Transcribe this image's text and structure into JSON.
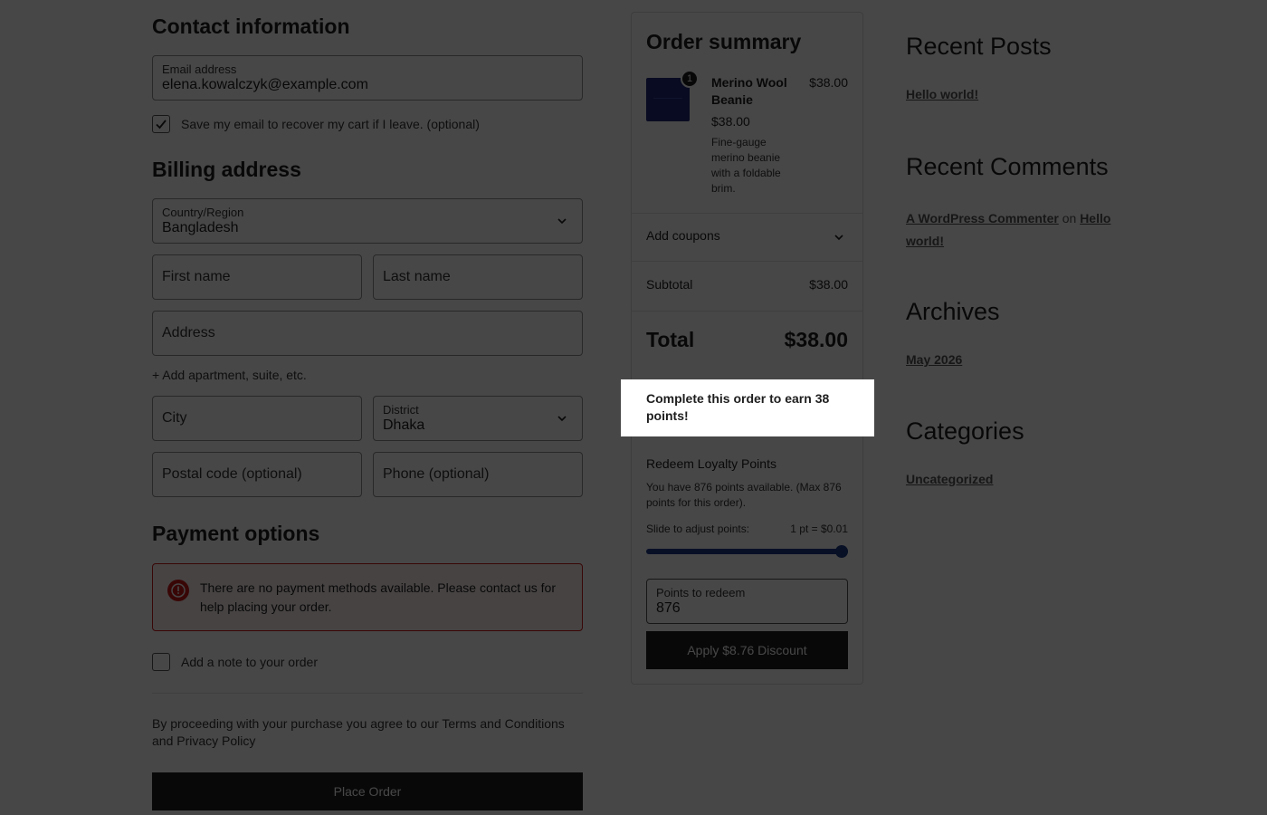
{
  "contact": {
    "title": "Contact information",
    "email_label": "Email address",
    "email_value": "elena.kowalczyk@example.com",
    "save_email_label": "Save my email to recover my cart if I leave. (optional)",
    "save_email_checked": true
  },
  "billing": {
    "title": "Billing address",
    "country_label": "Country/Region",
    "country_value": "Bangladesh",
    "first_name_placeholder": "First name",
    "last_name_placeholder": "Last name",
    "address_placeholder": "Address",
    "add_apartment": "+ Add apartment, suite, etc.",
    "city_placeholder": "City",
    "district_label": "District",
    "district_value": "Dhaka",
    "postal_placeholder": "Postal code (optional)",
    "phone_placeholder": "Phone (optional)"
  },
  "payment": {
    "title": "Payment options",
    "error_text": "There are no payment methods available. Please contact us for help placing your order.",
    "add_note_label": "Add a note to your order",
    "terms_text": "By proceeding with your purchase you agree to our Terms and Conditions and Privacy Policy",
    "place_order": "Place Order"
  },
  "summary": {
    "title": "Order summary",
    "item": {
      "quantity": "1",
      "name": "Merino Wool Beanie",
      "line_price": "$38.00",
      "unit_price": "$38.00",
      "description": "Fine-gauge merino beanie with a foldable brim."
    },
    "coupons_label": "Add coupons",
    "subtotal_label": "Subtotal",
    "subtotal_value": "$38.00",
    "total_label": "Total",
    "total_value": "$38.00",
    "earn_points": "Complete this order to earn 38 points!",
    "redeem_title": "Redeem Loyalty Points",
    "points_available": "You have 876 points available. (Max 876 points for this order).",
    "slide_label": "Slide to adjust points:",
    "rate_label": "1 pt = $0.01",
    "slider_fraction": 1.0,
    "points_label": "Points to redeem",
    "points_value": "876",
    "apply_button": "Apply $8.76 Discount"
  },
  "widgets": {
    "recent_posts_title": "Recent Posts",
    "recent_post_1": "Hello world!",
    "recent_comments_title": "Recent Comments",
    "comment_author": "A WordPress Commenter",
    "comment_on": "on",
    "comment_post": "Hello world!",
    "archives_title": "Archives",
    "archive_1": "May 2026",
    "categories_title": "Categories",
    "category_1": "Uncategorized"
  },
  "colors": {
    "accent": "#1e3a8a",
    "error": "#cc1818",
    "button_bg": "#1e1e1e"
  }
}
